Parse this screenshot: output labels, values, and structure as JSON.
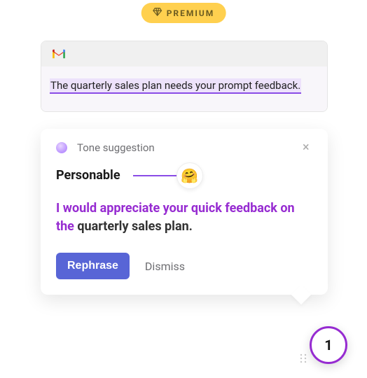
{
  "premium": {
    "label": "PREMIUM"
  },
  "email": {
    "body_highlighted": "The quarterly sales plan needs your prompt feedback."
  },
  "suggestion": {
    "header": "Tone suggestion",
    "tone_name": "Personable",
    "emoji": "🤗",
    "text_emphasized": "I would appreciate your quick feedback on the",
    "text_rest": " quarterly sales plan.",
    "rephrase_label": "Rephrase",
    "dismiss_label": "Dismiss"
  },
  "fab": {
    "count": "1"
  }
}
